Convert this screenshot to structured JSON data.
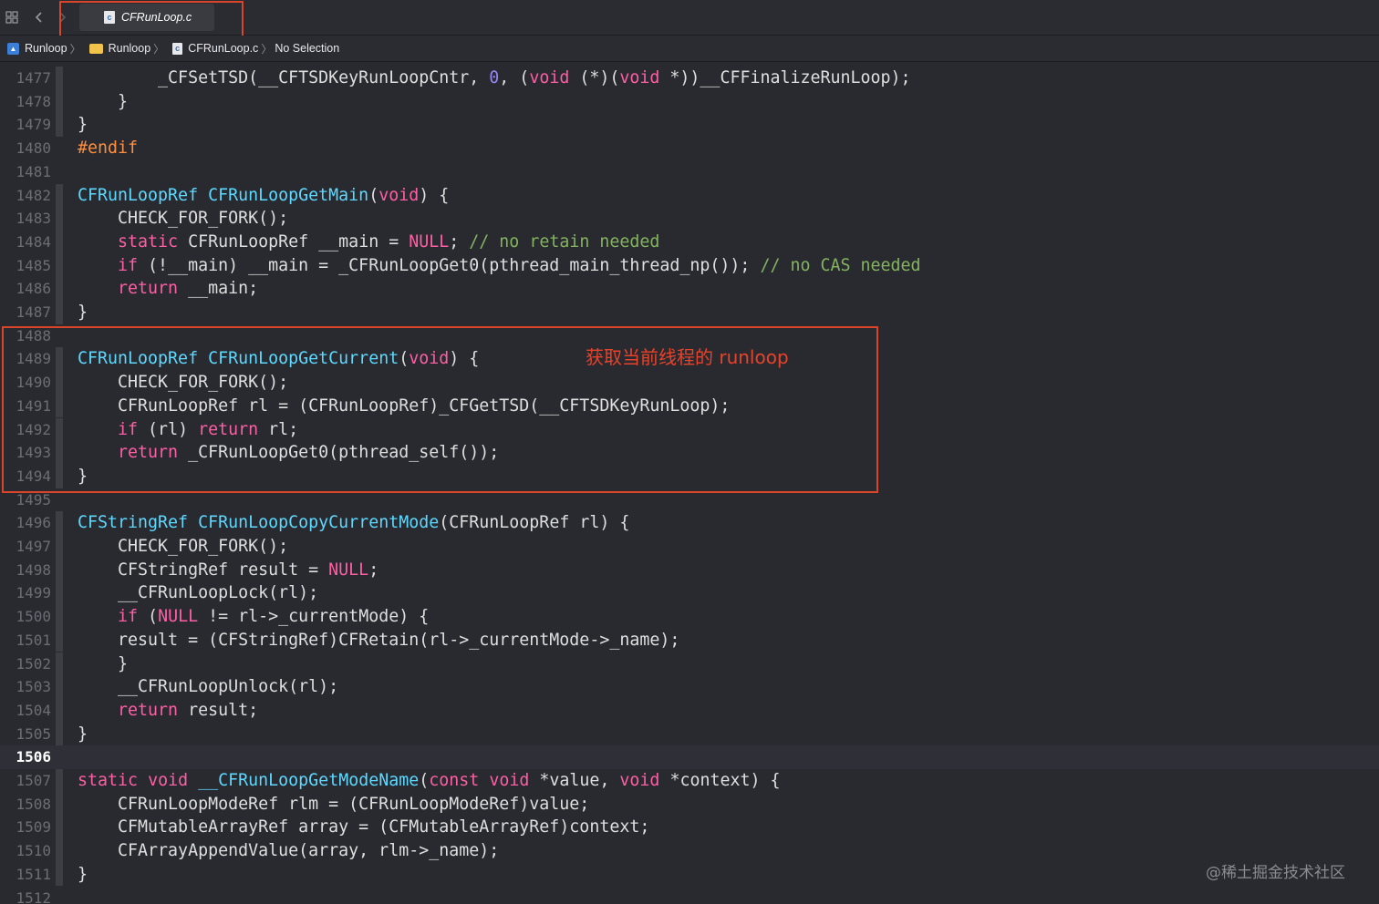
{
  "tab": {
    "title": "CFRunLoop.c",
    "icon": "c-file-icon"
  },
  "breadcrumb": [
    {
      "label": "Runloop",
      "icon": "project-icon"
    },
    {
      "label": "Runloop",
      "icon": "folder-icon"
    },
    {
      "label": "CFRunLoop.c",
      "icon": "c-file-icon"
    },
    {
      "label": "No Selection",
      "icon": ""
    }
  ],
  "editor": {
    "current_line": 1506,
    "lines": [
      {
        "n": 1477,
        "fold": true,
        "html": "        _CFSetTSD(__CFTSDKeyRunLoopCntr, <span class=\"num\">0</span>, (<span class=\"kw\">void</span> (*)(<span class=\"kw\">void</span> *))__CFFinalizeRunLoop);"
      },
      {
        "n": 1478,
        "fold": true,
        "html": "    }"
      },
      {
        "n": 1479,
        "fold": true,
        "html": "}"
      },
      {
        "n": 1480,
        "fold": false,
        "html": "<span class=\"pp\">#endif</span>"
      },
      {
        "n": 1481,
        "fold": false,
        "html": ""
      },
      {
        "n": 1482,
        "fold": true,
        "html": "<span class=\"tp\">CFRunLoopRef</span> <span class=\"fn\">CFRunLoopGetMain</span>(<span class=\"kw\">void</span>) {"
      },
      {
        "n": 1483,
        "fold": true,
        "html": "    CHECK_FOR_FORK();"
      },
      {
        "n": 1484,
        "fold": true,
        "html": "    <span class=\"kw\">static</span> CFRunLoopRef __main = <span class=\"kw\">NULL</span>; <span class=\"cmt\">// no retain needed</span>"
      },
      {
        "n": 1485,
        "fold": true,
        "html": "    <span class=\"kw\">if</span> (!__main) __main = _CFRunLoopGet0(pthread_main_thread_np()); <span class=\"cmt\">// no CAS needed</span>"
      },
      {
        "n": 1486,
        "fold": true,
        "html": "    <span class=\"kw\">return</span> __main;"
      },
      {
        "n": 1487,
        "fold": true,
        "html": "}"
      },
      {
        "n": 1488,
        "fold": false,
        "html": ""
      },
      {
        "n": 1489,
        "fold": true,
        "html": "<span class=\"tp\">CFRunLoopRef</span> <span class=\"fn\">CFRunLoopGetCurrent</span>(<span class=\"kw\">void</span>) {"
      },
      {
        "n": 1490,
        "fold": true,
        "html": "    CHECK_FOR_FORK();"
      },
      {
        "n": 1491,
        "fold": true,
        "html": "    CFRunLoopRef rl = (CFRunLoopRef)_CFGetTSD(__CFTSDKeyRunLoop);"
      },
      {
        "n": 1492,
        "fold": true,
        "html": "    <span class=\"kw\">if</span> (rl) <span class=\"kw\">return</span> rl;"
      },
      {
        "n": 1493,
        "fold": true,
        "html": "    <span class=\"kw\">return</span> _CFRunLoopGet0(pthread_self());"
      },
      {
        "n": 1494,
        "fold": true,
        "html": "}"
      },
      {
        "n": 1495,
        "fold": false,
        "html": ""
      },
      {
        "n": 1496,
        "fold": true,
        "html": "<span class=\"tp\">CFStringRef</span> <span class=\"fn\">CFRunLoopCopyCurrentMode</span>(CFRunLoopRef rl) {"
      },
      {
        "n": 1497,
        "fold": true,
        "html": "    CHECK_FOR_FORK();"
      },
      {
        "n": 1498,
        "fold": true,
        "html": "    CFStringRef result = <span class=\"kw\">NULL</span>;"
      },
      {
        "n": 1499,
        "fold": true,
        "html": "    __CFRunLoopLock(rl);"
      },
      {
        "n": 1500,
        "fold": true,
        "html": "    <span class=\"kw\">if</span> (<span class=\"kw\">NULL</span> != rl->_currentMode) {"
      },
      {
        "n": 1501,
        "fold": true,
        "html": "    result = (CFStringRef)CFRetain(rl->_currentMode->_name);"
      },
      {
        "n": 1502,
        "fold": true,
        "html": "    }"
      },
      {
        "n": 1503,
        "fold": true,
        "html": "    __CFRunLoopUnlock(rl);"
      },
      {
        "n": 1504,
        "fold": true,
        "html": "    <span class=\"kw\">return</span> result;"
      },
      {
        "n": 1505,
        "fold": true,
        "html": "}"
      },
      {
        "n": 1506,
        "fold": false,
        "html": ""
      },
      {
        "n": 1507,
        "fold": true,
        "html": "<span class=\"kw\">static</span> <span class=\"kw\">void</span> <span class=\"fn\">__CFRunLoopGetModeName</span>(<span class=\"kw\">const</span> <span class=\"kw\">void</span> *value, <span class=\"kw\">void</span> *context) {"
      },
      {
        "n": 1508,
        "fold": true,
        "html": "    CFRunLoopModeRef rlm = (CFRunLoopModeRef)value;"
      },
      {
        "n": 1509,
        "fold": true,
        "html": "    CFMutableArrayRef array = (CFMutableArrayRef)context;"
      },
      {
        "n": 1510,
        "fold": true,
        "html": "    CFArrayAppendValue(array, rlm->_name);"
      },
      {
        "n": 1511,
        "fold": true,
        "html": "}"
      },
      {
        "n": 1512,
        "fold": false,
        "html": ""
      }
    ]
  },
  "annotation": {
    "text": "获取当前线程的 runloop",
    "color": "#e8432a"
  },
  "watermark": "@稀土掘金技术社区",
  "colors": {
    "keyword": "#fc5fa3",
    "type": "#5dd8ff",
    "preprocessor": "#fd8f3f",
    "comment": "#84b360",
    "number": "#9686f5",
    "highlight_box": "#d9452b"
  }
}
